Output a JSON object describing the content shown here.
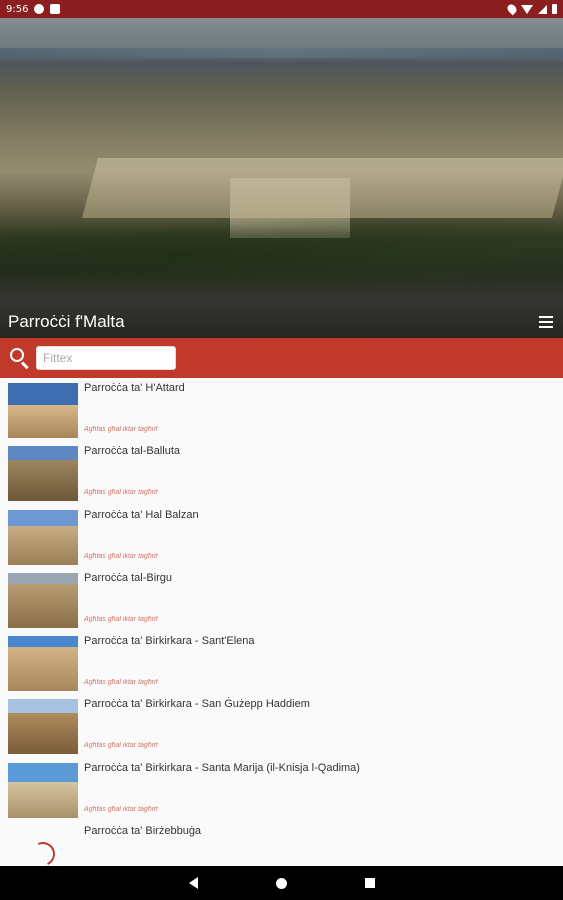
{
  "status_bar": {
    "time": "9:56"
  },
  "header": {
    "title": "Parroċċi f'Malta"
  },
  "search": {
    "placeholder": "Fittex"
  },
  "list": {
    "items": [
      {
        "title": "Parroċċa ta' H'Attard",
        "note": "Agħfas għal iktar tagħrif",
        "thumb": {
          "sky": "#3d6fb0",
          "building": "#c9a874"
        }
      },
      {
        "title": "Parroċċa tal-Balluta",
        "note": "Agħfas għal iktar tagħrif",
        "thumb": {
          "sky": "#5d88c4",
          "building": "#8c7352"
        }
      },
      {
        "title": "Parroċċa ta' Hal Balzan",
        "note": "Agħfas għal iktar tagħrif",
        "thumb": {
          "sky": "#6d98d4",
          "building": "#b99d74"
        }
      },
      {
        "title": "Parroċċa tal-Birgu",
        "note": "Agħfas għal iktar tagħrif",
        "thumb": {
          "sky": "#9aa7b3",
          "building": "#a88c62"
        }
      },
      {
        "title": "Parroċċa ta' Birkirkara - Sant'Elena",
        "note": "Agħfas għal iktar tagħrif",
        "thumb": {
          "sky": "#4a86d0",
          "building": "#c6a778"
        }
      },
      {
        "title": "Parroċċa ta' Birkirkara - San Ġużepp Haddiem",
        "note": "Agħfas għal iktar tagħrif",
        "thumb": {
          "sky": "#a7c2e0",
          "building": "#9d7d52"
        }
      },
      {
        "title": "Parroċċa ta' Birkirkara - Santa Marija (il-Knisja l-Qadima)",
        "note": "Agħfas għal iktar tagħrif",
        "thumb": {
          "sky": "#5a9ad8",
          "building": "#c4b08a"
        }
      },
      {
        "title": "Parroċċa ta' Birżebbuġa",
        "note": "",
        "thumb": null
      }
    ]
  },
  "nav": {
    "back": "back-icon",
    "home": "home-icon",
    "recent": "recent-apps-icon"
  },
  "colors": {
    "accent": "#c0392b",
    "status_bar": "#8b1f1f"
  }
}
